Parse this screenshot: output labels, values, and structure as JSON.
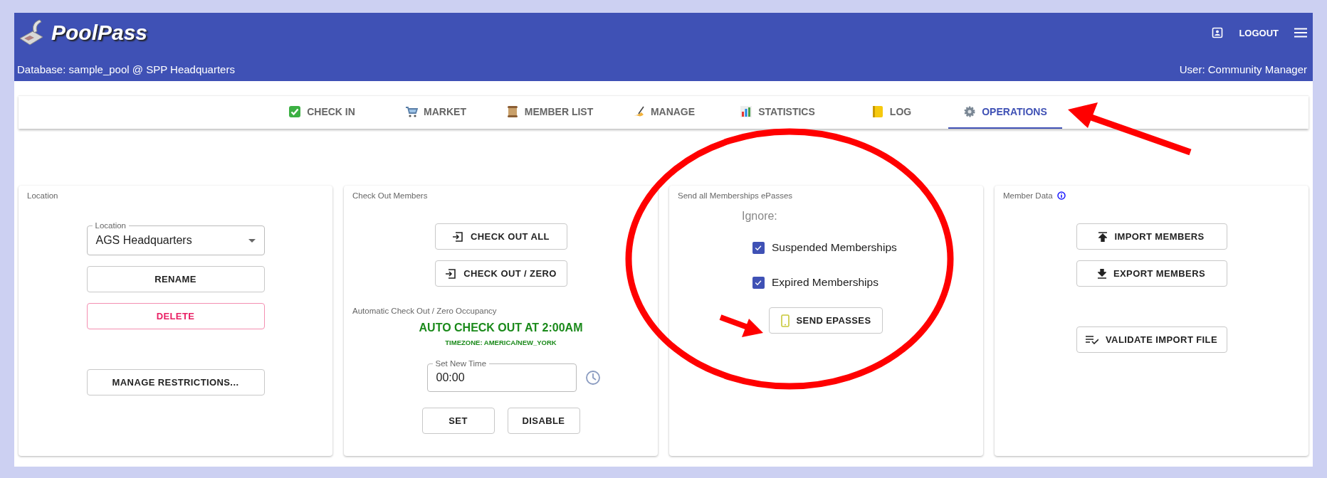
{
  "header": {
    "app_name": "PoolPass",
    "database": "Database: sample_pool @ SPP Headquarters",
    "logout": "LOGOUT",
    "user": "User: Community Manager"
  },
  "tabs": [
    {
      "label": "CHECK IN",
      "kind": "check",
      "selected": false
    },
    {
      "label": "MARKET",
      "kind": "cart",
      "selected": false
    },
    {
      "label": "MEMBER LIST",
      "kind": "scroll",
      "selected": false
    },
    {
      "label": "MANAGE",
      "kind": "pen",
      "selected": false
    },
    {
      "label": "STATISTICS",
      "kind": "chart",
      "selected": false
    },
    {
      "label": "LOG",
      "kind": "note",
      "selected": false
    },
    {
      "label": "OPERATIONS",
      "kind": "gear",
      "selected": true
    }
  ],
  "location_card": {
    "title": "Location",
    "select": {
      "label": "Location",
      "value": "AGS Headquarters"
    },
    "rename": "RENAME",
    "delete": "DELETE",
    "restrictions": "MANAGE RESTRICTIONS..."
  },
  "checkout_card": {
    "title": "Check Out Members",
    "check_out_all": "CHECK OUT ALL",
    "check_out_zero": "CHECK OUT / ZERO",
    "auto_label": "Automatic Check Out / Zero Occupancy",
    "auto_status": "AUTO CHECK OUT AT 2:00AM",
    "timezone": "TIMEZONE: AMERICA/NEW_YORK",
    "time_field": {
      "label": "Set New Time",
      "value": "00:00"
    },
    "set": "SET",
    "disable": "DISABLE"
  },
  "epasses_card": {
    "title": "Send all Memberships ePasses",
    "ignore_label": "Ignore:",
    "options": [
      {
        "label": "Suspended Memberships",
        "checked": true
      },
      {
        "label": "Expired Memberships",
        "checked": true
      }
    ],
    "send": "SEND EPASSES"
  },
  "member_data_card": {
    "title": "Member Data",
    "import": "IMPORT MEMBERS",
    "export": "EXPORT MEMBERS",
    "validate": "VALIDATE IMPORT FILE"
  }
}
